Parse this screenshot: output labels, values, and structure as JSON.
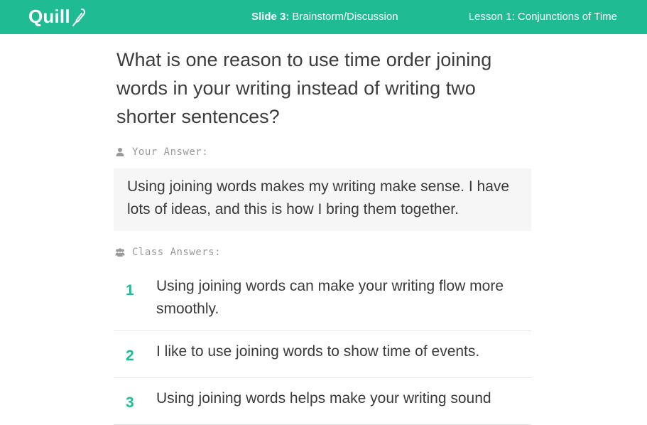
{
  "header": {
    "logo_text": "Quill",
    "logo_icon": "quill-pen-icon",
    "slide_number": "Slide 3:",
    "slide_name": "Brainstorm/Discussion",
    "lesson": "Lesson 1: Conjunctions of Time",
    "brand_color": "#1fbc93"
  },
  "question": "What is one reason to use time order joining words in your writing instead of writing two shorter sentences?",
  "your_answer": {
    "label": "Your Answer:",
    "icon": "user-icon",
    "text": "Using joining words makes my writing make sense. I have lots of ideas, and this is how I bring them together."
  },
  "class_answers": {
    "label": "Class Answers:",
    "icon": "users-icon",
    "items": [
      {
        "num": "1",
        "text": "Using joining words can make your writing flow more smoothly."
      },
      {
        "num": "2",
        "text": "I like to use joining words to show time of events."
      },
      {
        "num": "3",
        "text": "Using joining words helps make your writing sound"
      }
    ]
  }
}
